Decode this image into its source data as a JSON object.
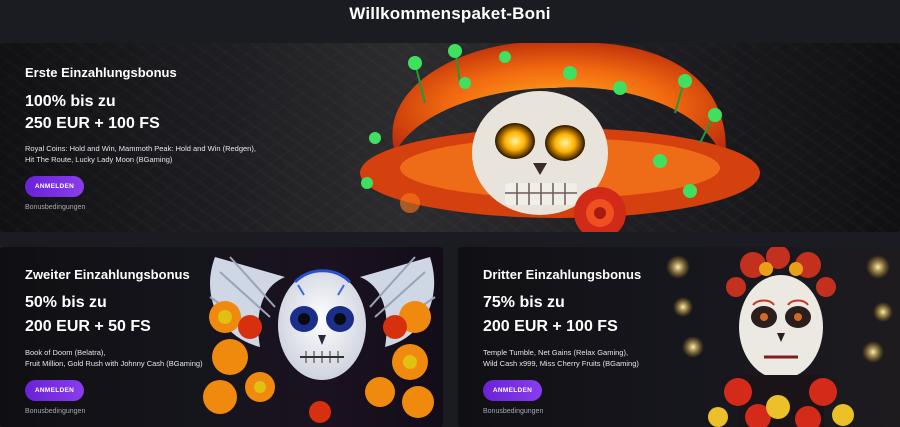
{
  "page": {
    "title": "Willkommenspaket-Boni"
  },
  "offers": [
    {
      "label": "Erste Einzahlungsbonus",
      "line1": "100% bis zu",
      "line2": "250 EUR + 100 FS",
      "games_line1": "Royal Coins: Hold and Win, Mammoth Peak: Hold and Win (Redgen),",
      "games_line2": "Hit The Route, Lucky Lady Moon (BGaming)",
      "button": "ANMELDEN",
      "terms": "Bonusbedingungen"
    },
    {
      "label": "Zweiter Einzahlungsbonus",
      "line1": "50% bis zu",
      "line2": "200 EUR + 50 FS",
      "games_line1": "Book of Doom (Belatra),",
      "games_line2": "Fruit Million, Gold Rush with Johnny Cash (BGaming)",
      "button": "ANMELDEN",
      "terms": "Bonusbedingungen"
    },
    {
      "label": "Dritter Einzahlungsbonus",
      "line1": "75% bis zu",
      "line2": "200 EUR + 100 FS",
      "games_line1": "Temple Tumble, Net Gains (Relax Gaming),",
      "games_line2": "Wild Cash x999, Miss Cherry Fruits (BGaming)",
      "button": "ANMELDEN",
      "terms": "Bonusbedingungen"
    }
  ],
  "colors": {
    "background": "#1b1b22",
    "button": "#7a30e6",
    "accent_orange": "#ff6a00"
  }
}
